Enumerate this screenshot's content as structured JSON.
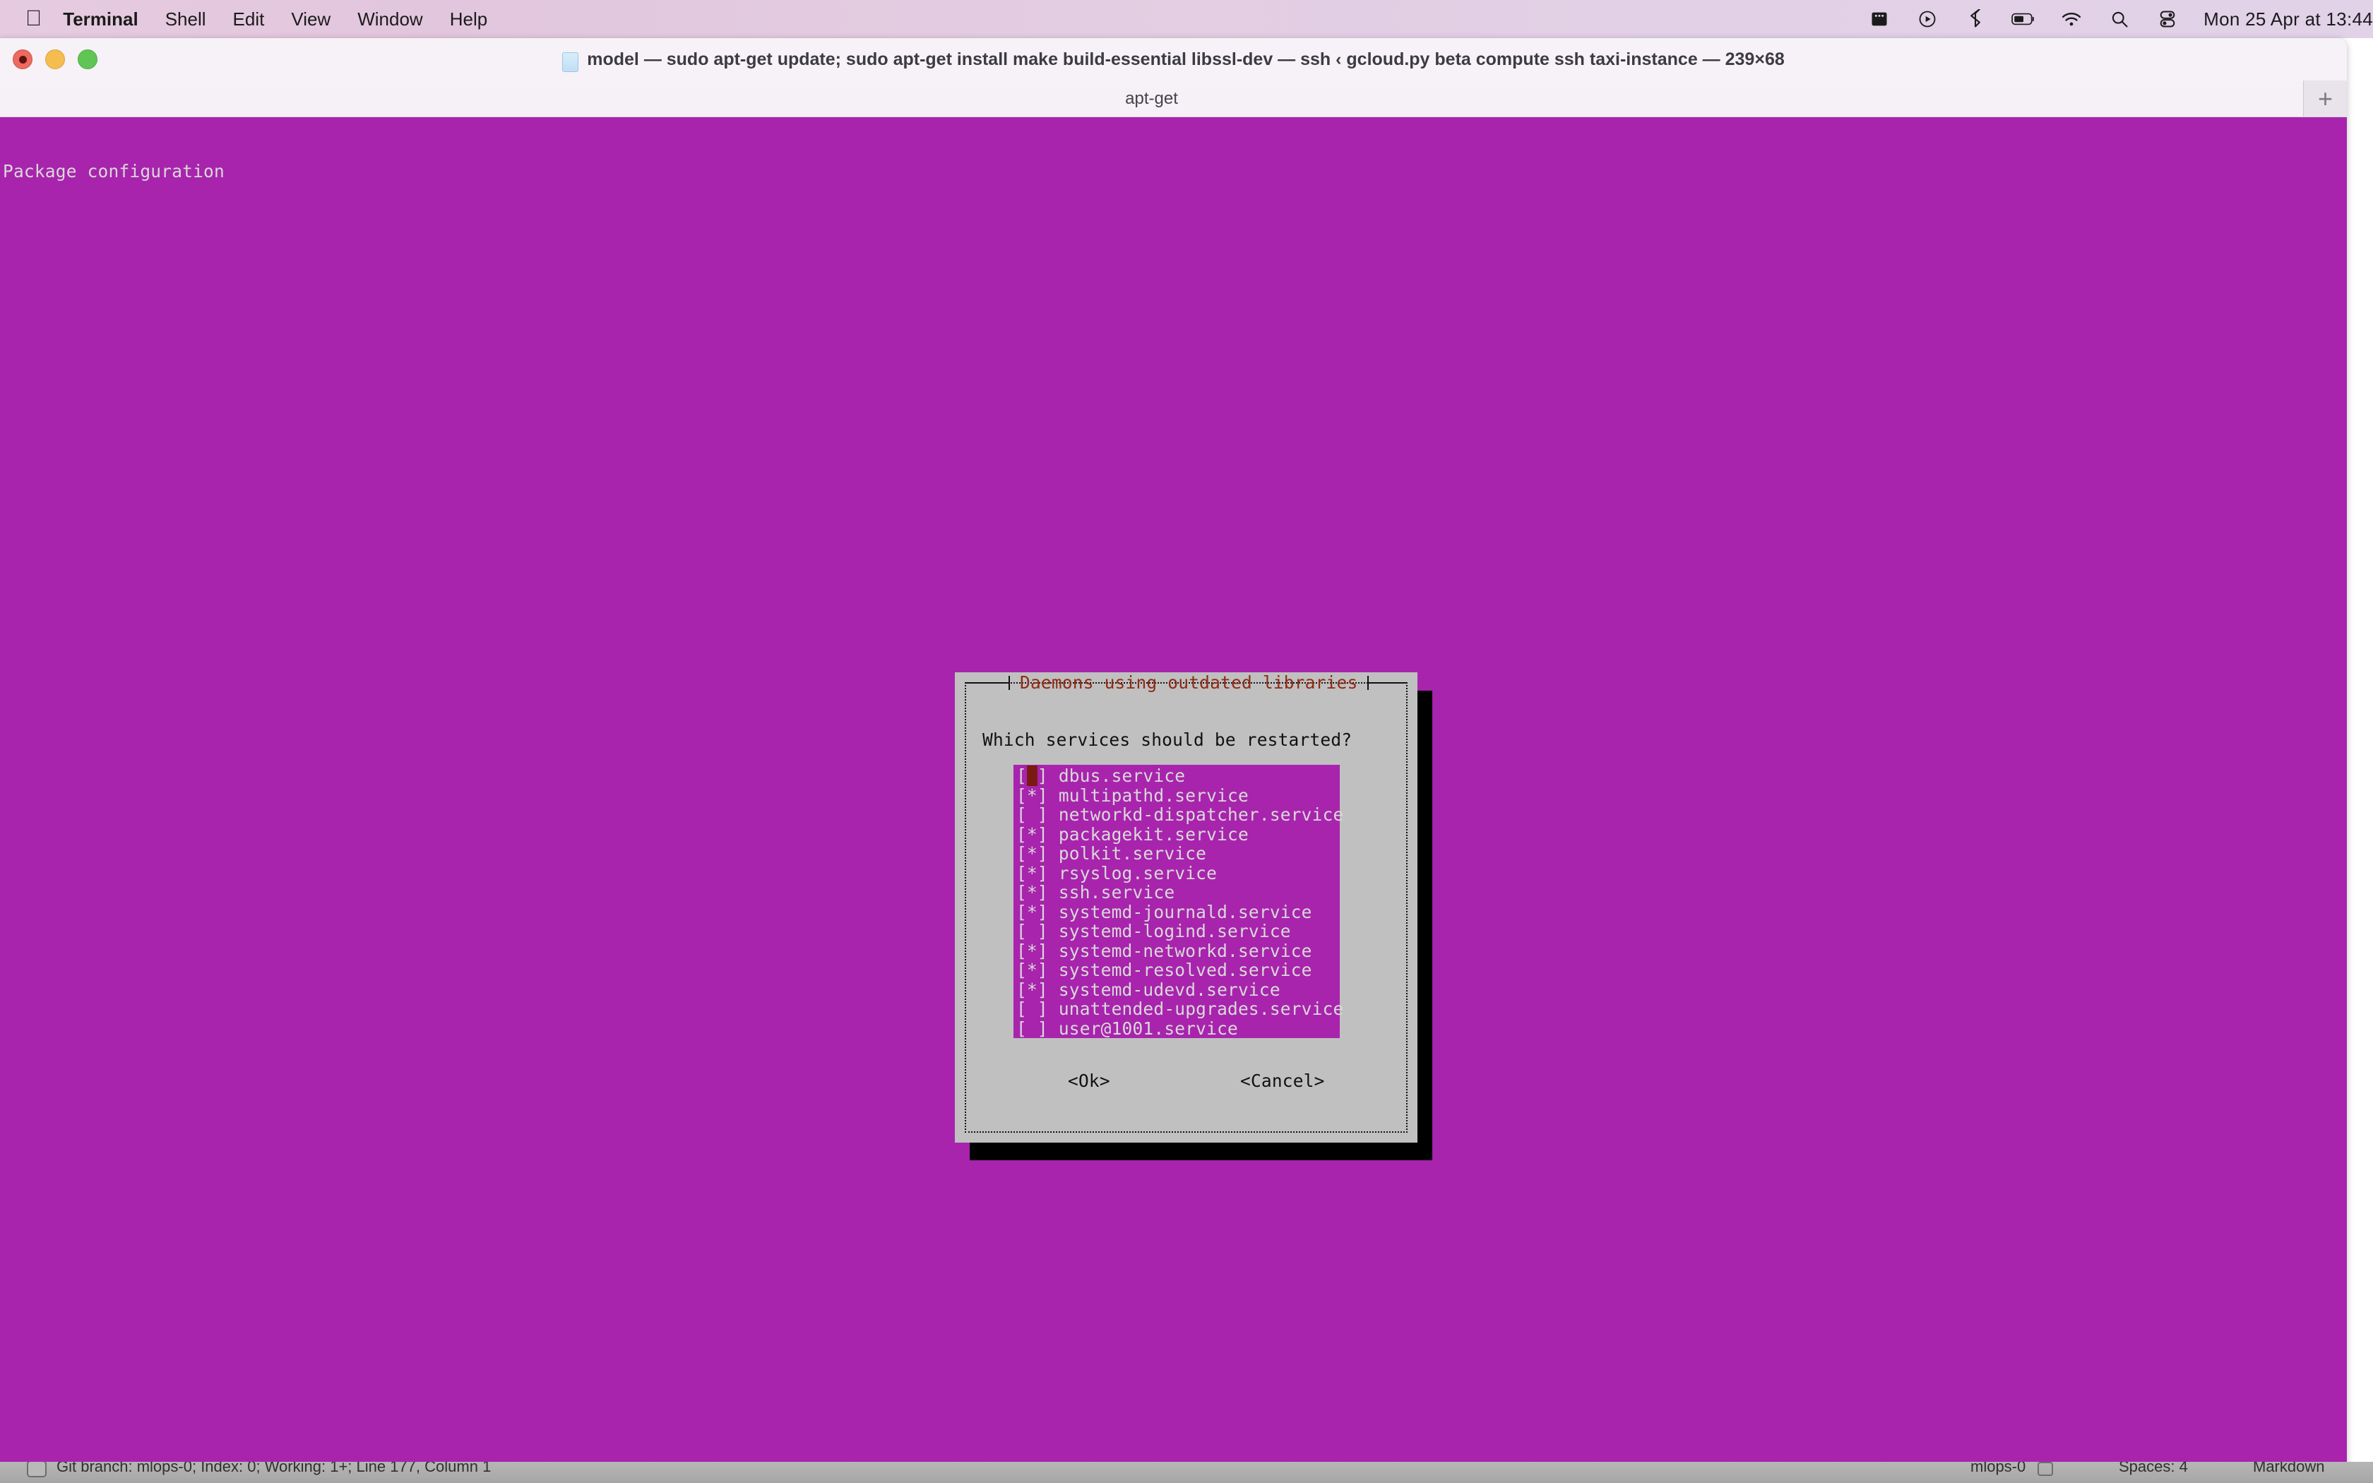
{
  "menubar": {
    "apple_glyph": "",
    "items": [
      {
        "label": "Terminal",
        "bold": true
      },
      {
        "label": "Shell",
        "bold": false
      },
      {
        "label": "Edit",
        "bold": false
      },
      {
        "label": "View",
        "bold": false
      },
      {
        "label": "Window",
        "bold": false
      },
      {
        "label": "Help",
        "bold": false
      }
    ],
    "tray_icons": [
      "screen-recording-icon",
      "now-playing-icon",
      "bluetooth-icon",
      "battery-icon",
      "wifi-icon",
      "spotlight-search-icon",
      "control-center-icon"
    ],
    "clock": "Mon 25 Apr at  13:44"
  },
  "window": {
    "title": "model — sudo apt-get update; sudo apt-get install make build-essential libssl-dev   — ssh ‹ gcloud.py beta compute ssh taxi-instance — 239×68",
    "file_icon": "document-icon",
    "traffic_lights": [
      "close-button",
      "minimize-button",
      "zoom-button"
    ],
    "tab_label": "apt-get",
    "new_tab_glyph": "+"
  },
  "terminal": {
    "background": "#a824ad",
    "foreground": "#d9d9d9",
    "header_line": "Package configuration"
  },
  "dialog": {
    "title": "Daemons using outdated libraries",
    "title_color": "#8f2a16",
    "background": "#c0c0c0",
    "prompt": "Which services should be restarted?",
    "services": [
      {
        "checkbox": "[ ]",
        "name": "dbus.service",
        "checked": false,
        "cursor": true
      },
      {
        "checkbox": "[*]",
        "name": "multipathd.service",
        "checked": true,
        "cursor": false
      },
      {
        "checkbox": "[ ]",
        "name": "networkd-dispatcher.service",
        "checked": false,
        "cursor": false
      },
      {
        "checkbox": "[*]",
        "name": "packagekit.service",
        "checked": true,
        "cursor": false
      },
      {
        "checkbox": "[*]",
        "name": "polkit.service",
        "checked": true,
        "cursor": false
      },
      {
        "checkbox": "[*]",
        "name": "rsyslog.service",
        "checked": true,
        "cursor": false
      },
      {
        "checkbox": "[*]",
        "name": "ssh.service",
        "checked": true,
        "cursor": false
      },
      {
        "checkbox": "[*]",
        "name": "systemd-journald.service",
        "checked": true,
        "cursor": false
      },
      {
        "checkbox": "[ ]",
        "name": "systemd-logind.service",
        "checked": false,
        "cursor": false
      },
      {
        "checkbox": "[*]",
        "name": "systemd-networkd.service",
        "checked": true,
        "cursor": false
      },
      {
        "checkbox": "[*]",
        "name": "systemd-resolved.service",
        "checked": true,
        "cursor": false
      },
      {
        "checkbox": "[*]",
        "name": "systemd-udevd.service",
        "checked": true,
        "cursor": false
      },
      {
        "checkbox": "[ ]",
        "name": "unattended-upgrades.service",
        "checked": false,
        "cursor": false
      },
      {
        "checkbox": "[ ]",
        "name": "user@1001.service",
        "checked": false,
        "cursor": false
      }
    ],
    "ok_label": "<Ok>",
    "cancel_label": "<Cancel>"
  },
  "background_status_bar": {
    "left_text": "Git branch: mlops-0; Index: 0; Working: 1+; Line 177, Column 1",
    "branch": "mlops-0",
    "spaces": "Spaces: 4",
    "language": "Markdown"
  }
}
